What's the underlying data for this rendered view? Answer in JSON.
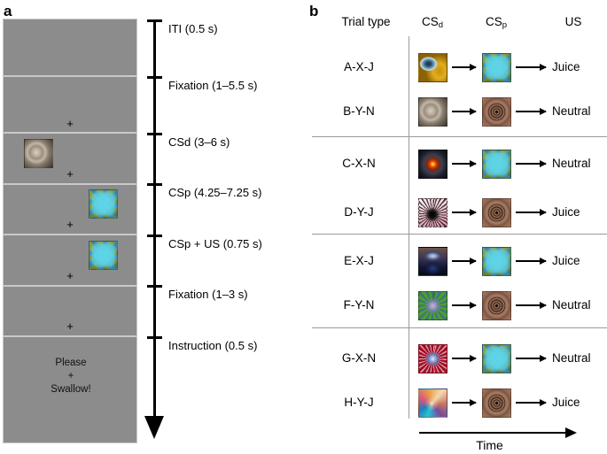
{
  "figure": {
    "panel_a_label": "a",
    "panel_b_label": "b"
  },
  "panel_a": {
    "screens": [
      {
        "name": "iti-screen",
        "fixation": "",
        "stimulus": null,
        "text": null
      },
      {
        "name": "fixation-screen-1",
        "fixation": "+",
        "stimulus": null,
        "text": null
      },
      {
        "name": "csd-screen",
        "fixation": "+",
        "stimulus": "B",
        "stimulus_side": "left",
        "text": null
      },
      {
        "name": "csp-screen",
        "fixation": "+",
        "stimulus": "X",
        "stimulus_side": "right",
        "text": null
      },
      {
        "name": "csp-us-screen",
        "fixation": "+",
        "stimulus": "X",
        "stimulus_side": "right",
        "text": null
      },
      {
        "name": "fixation-screen-2",
        "fixation": "+",
        "stimulus": null,
        "text": null
      },
      {
        "name": "instruction-screen",
        "fixation": "+",
        "stimulus": null,
        "text_top": "Please",
        "text_bottom": "Swallow!"
      }
    ],
    "timeline": {
      "phases": [
        "ITI (0.5 s)",
        "Fixation (1–5.5 s)",
        "CSd (3–6 s)",
        "CSp (4.25–7.25 s)",
        "CSp + US (0.75 s)",
        "Fixation (1–3 s)",
        "Instruction (0.5 s)"
      ]
    }
  },
  "panel_b": {
    "columns": [
      "Trial type",
      "CS",
      "CS",
      "US"
    ],
    "column_subscripts": [
      "",
      "d",
      "p",
      ""
    ],
    "rows": [
      {
        "trial_type": "A-X-J",
        "csd": "A",
        "csp": "X",
        "us": "Juice"
      },
      {
        "trial_type": "B-Y-N",
        "csd": "B",
        "csp": "Y",
        "us": "Neutral"
      },
      {
        "trial_type": "C-X-N",
        "csd": "C",
        "csp": "X",
        "us": "Neutral"
      },
      {
        "trial_type": "D-Y-J",
        "csd": "D",
        "csp": "Y",
        "us": "Juice"
      },
      {
        "trial_type": "E-X-J",
        "csd": "E",
        "csp": "X",
        "us": "Juice"
      },
      {
        "trial_type": "F-Y-N",
        "csd": "F",
        "csp": "Y",
        "us": "Neutral"
      },
      {
        "trial_type": "G-X-N",
        "csd": "G",
        "csp": "X",
        "us": "Neutral"
      },
      {
        "trial_type": "H-Y-J",
        "csd": "H",
        "csp": "Y",
        "us": "Juice"
      }
    ],
    "time_axis_label": "Time"
  },
  "colors": {
    "screen_background": "#8c8c8c",
    "divider": "#9a9a9a",
    "axis": "#000000"
  }
}
